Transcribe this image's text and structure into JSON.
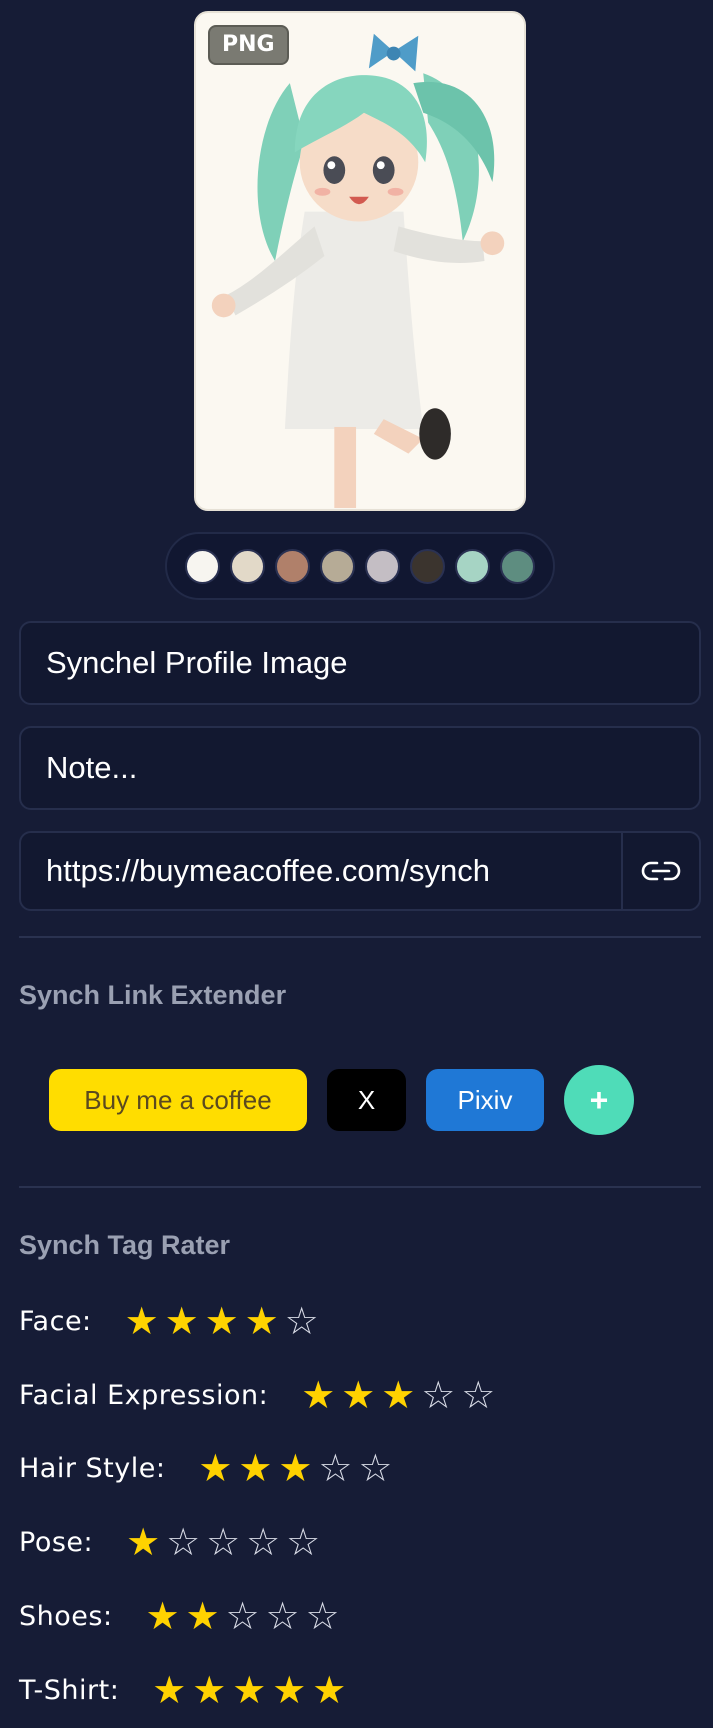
{
  "image": {
    "badge": "PNG",
    "palette": [
      "#f7f5f0",
      "#e2d9c8",
      "#b0806a",
      "#b6ab96",
      "#c4bec4",
      "#3b342e",
      "#a6d4c4",
      "#5e8d80"
    ]
  },
  "title_field": {
    "value": "Synchel Profile Image"
  },
  "note_field": {
    "placeholder": "Note..."
  },
  "url_field": {
    "value": "https://buymeacoffee.com/synch"
  },
  "link_extender": {
    "title": "Synch Link Extender",
    "links": [
      {
        "label": "Buy me a coffee"
      },
      {
        "label": "X"
      },
      {
        "label": "Pixiv"
      }
    ],
    "add_label": "+"
  },
  "tag_rater": {
    "title": "Synch Tag Rater",
    "max": 5,
    "ratings": [
      {
        "label": "Face:",
        "value": 4
      },
      {
        "label": "Facial Expression:",
        "value": 3
      },
      {
        "label": "Hair Style:",
        "value": 3
      },
      {
        "label": "Pose:",
        "value": 1
      },
      {
        "label": "Shoes:",
        "value": 2
      },
      {
        "label": "T-Shirt:",
        "value": 5
      }
    ]
  }
}
